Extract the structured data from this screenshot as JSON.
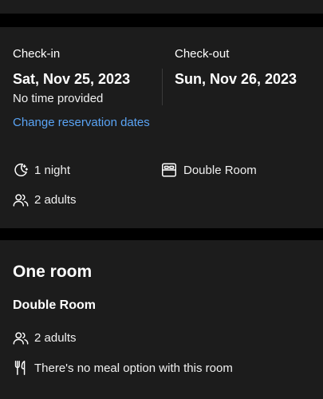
{
  "booking": {
    "checkin_label": "Check-in",
    "checkin_date": "Sat, Nov 25, 2023",
    "checkin_time": "No time provided",
    "checkout_label": "Check-out",
    "checkout_date": "Sun, Nov 26, 2023",
    "change_dates_link": "Change reservation dates",
    "nights": "1 night",
    "room_type": "Double Room",
    "guests": "2 adults"
  },
  "room_section": {
    "title": "One room",
    "room_name": "Double Room",
    "guests": "2 adults",
    "meal_info": "There's no meal option with this room"
  },
  "icons": {
    "nights": "moon-stars-icon",
    "room": "bed-icon",
    "guests": "people-icon",
    "meal": "fork-knife-icon"
  },
  "colors": {
    "background": "#000000",
    "card": "#1c1c1c",
    "link": "#5aa4f5"
  }
}
